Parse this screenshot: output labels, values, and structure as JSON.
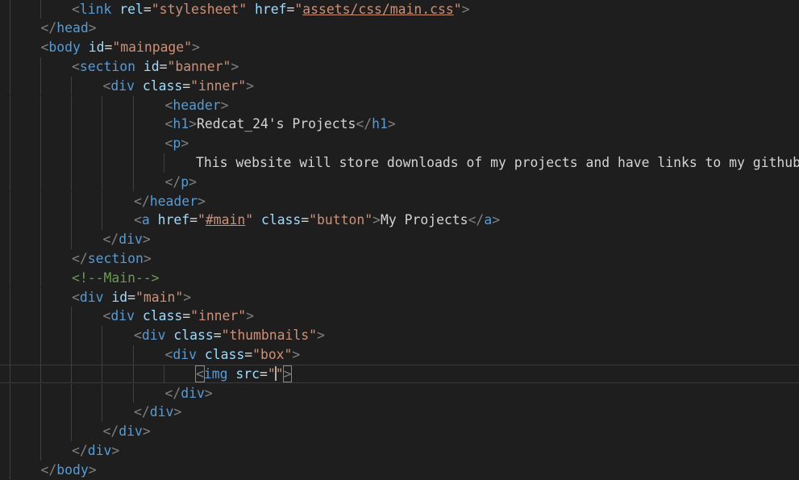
{
  "editor": {
    "language": "html",
    "lines": [
      {
        "indent": 2,
        "tokens": [
          {
            "k": "p",
            "v": "<"
          },
          {
            "k": "t",
            "v": "link"
          },
          {
            "k": "x",
            "v": " "
          },
          {
            "k": "a",
            "v": "rel"
          },
          {
            "k": "x",
            "v": "="
          },
          {
            "k": "s",
            "v": "\"stylesheet\""
          },
          {
            "k": "x",
            "v": " "
          },
          {
            "k": "a",
            "v": "href"
          },
          {
            "k": "x",
            "v": "="
          },
          {
            "k": "s",
            "v": "\""
          },
          {
            "k": "s",
            "v": "assets/css/main.css",
            "link": true
          },
          {
            "k": "s",
            "v": "\""
          },
          {
            "k": "p",
            "v": ">"
          }
        ]
      },
      {
        "indent": 1,
        "tokens": [
          {
            "k": "p",
            "v": "</"
          },
          {
            "k": "t",
            "v": "head"
          },
          {
            "k": "p",
            "v": ">"
          }
        ]
      },
      {
        "indent": 1,
        "tokens": [
          {
            "k": "p",
            "v": "<"
          },
          {
            "k": "t",
            "v": "body"
          },
          {
            "k": "x",
            "v": " "
          },
          {
            "k": "a",
            "v": "id"
          },
          {
            "k": "x",
            "v": "="
          },
          {
            "k": "s",
            "v": "\"mainpage\""
          },
          {
            "k": "p",
            "v": ">"
          }
        ]
      },
      {
        "indent": 2,
        "tokens": [
          {
            "k": "p",
            "v": "<"
          },
          {
            "k": "t",
            "v": "section"
          },
          {
            "k": "x",
            "v": " "
          },
          {
            "k": "a",
            "v": "id"
          },
          {
            "k": "x",
            "v": "="
          },
          {
            "k": "s",
            "v": "\"banner\""
          },
          {
            "k": "p",
            "v": ">"
          }
        ]
      },
      {
        "indent": 3,
        "tokens": [
          {
            "k": "p",
            "v": "<"
          },
          {
            "k": "t",
            "v": "div"
          },
          {
            "k": "x",
            "v": " "
          },
          {
            "k": "a",
            "v": "class"
          },
          {
            "k": "x",
            "v": "="
          },
          {
            "k": "s",
            "v": "\"inner\""
          },
          {
            "k": "p",
            "v": ">"
          }
        ]
      },
      {
        "indent": 5,
        "tokens": [
          {
            "k": "p",
            "v": "<"
          },
          {
            "k": "t",
            "v": "header"
          },
          {
            "k": "p",
            "v": ">"
          }
        ]
      },
      {
        "indent": 5,
        "tokens": [
          {
            "k": "p",
            "v": "<"
          },
          {
            "k": "t",
            "v": "h1"
          },
          {
            "k": "p",
            "v": ">"
          },
          {
            "k": "x",
            "v": "Redcat_24's Projects"
          },
          {
            "k": "p",
            "v": "</"
          },
          {
            "k": "t",
            "v": "h1"
          },
          {
            "k": "p",
            "v": ">"
          }
        ]
      },
      {
        "indent": 5,
        "tokens": [
          {
            "k": "p",
            "v": "<"
          },
          {
            "k": "t",
            "v": "p"
          },
          {
            "k": "p",
            "v": ">"
          }
        ]
      },
      {
        "indent": 6,
        "tokens": [
          {
            "k": "x",
            "v": "This website will store downloads of my projects and have links to my github."
          }
        ]
      },
      {
        "indent": 5,
        "tokens": [
          {
            "k": "p",
            "v": "</"
          },
          {
            "k": "t",
            "v": "p"
          },
          {
            "k": "p",
            "v": ">"
          }
        ]
      },
      {
        "indent": 4,
        "tokens": [
          {
            "k": "p",
            "v": "</"
          },
          {
            "k": "t",
            "v": "header"
          },
          {
            "k": "p",
            "v": ">"
          }
        ]
      },
      {
        "indent": 4,
        "tokens": [
          {
            "k": "p",
            "v": "<"
          },
          {
            "k": "t",
            "v": "a"
          },
          {
            "k": "x",
            "v": " "
          },
          {
            "k": "a",
            "v": "href"
          },
          {
            "k": "x",
            "v": "="
          },
          {
            "k": "s",
            "v": "\""
          },
          {
            "k": "s",
            "v": "#main",
            "link": true
          },
          {
            "k": "s",
            "v": "\""
          },
          {
            "k": "x",
            "v": " "
          },
          {
            "k": "a",
            "v": "class"
          },
          {
            "k": "x",
            "v": "="
          },
          {
            "k": "s",
            "v": "\"button\""
          },
          {
            "k": "p",
            "v": ">"
          },
          {
            "k": "x",
            "v": "My Projects"
          },
          {
            "k": "p",
            "v": "</"
          },
          {
            "k": "t",
            "v": "a"
          },
          {
            "k": "p",
            "v": ">"
          }
        ]
      },
      {
        "indent": 3,
        "tokens": [
          {
            "k": "p",
            "v": "</"
          },
          {
            "k": "t",
            "v": "div"
          },
          {
            "k": "p",
            "v": ">"
          }
        ]
      },
      {
        "indent": 2,
        "tokens": [
          {
            "k": "p",
            "v": "</"
          },
          {
            "k": "t",
            "v": "section"
          },
          {
            "k": "p",
            "v": ">"
          }
        ]
      },
      {
        "indent": 2,
        "tokens": [
          {
            "k": "c",
            "v": "<!--Main-->"
          }
        ]
      },
      {
        "indent": 2,
        "tokens": [
          {
            "k": "p",
            "v": "<"
          },
          {
            "k": "t",
            "v": "div"
          },
          {
            "k": "x",
            "v": " "
          },
          {
            "k": "a",
            "v": "id"
          },
          {
            "k": "x",
            "v": "="
          },
          {
            "k": "s",
            "v": "\"main\""
          },
          {
            "k": "p",
            "v": ">"
          }
        ]
      },
      {
        "indent": 3,
        "tokens": [
          {
            "k": "p",
            "v": "<"
          },
          {
            "k": "t",
            "v": "div"
          },
          {
            "k": "x",
            "v": " "
          },
          {
            "k": "a",
            "v": "class"
          },
          {
            "k": "x",
            "v": "="
          },
          {
            "k": "s",
            "v": "\"inner\""
          },
          {
            "k": "p",
            "v": ">"
          }
        ]
      },
      {
        "indent": 4,
        "tokens": [
          {
            "k": "p",
            "v": "<"
          },
          {
            "k": "t",
            "v": "div"
          },
          {
            "k": "x",
            "v": " "
          },
          {
            "k": "a",
            "v": "class"
          },
          {
            "k": "x",
            "v": "="
          },
          {
            "k": "s",
            "v": "\"thumbnails\""
          },
          {
            "k": "p",
            "v": ">"
          }
        ]
      },
      {
        "indent": 5,
        "tokens": [
          {
            "k": "p",
            "v": "<"
          },
          {
            "k": "t",
            "v": "div"
          },
          {
            "k": "x",
            "v": " "
          },
          {
            "k": "a",
            "v": "class"
          },
          {
            "k": "x",
            "v": "="
          },
          {
            "k": "s",
            "v": "\"box\""
          },
          {
            "k": "p",
            "v": ">"
          }
        ]
      },
      {
        "indent": 6,
        "current": true,
        "tokens": [
          {
            "k": "p",
            "v": "<",
            "bracket": true
          },
          {
            "k": "t",
            "v": "img"
          },
          {
            "k": "x",
            "v": " "
          },
          {
            "k": "a",
            "v": "src"
          },
          {
            "k": "x",
            "v": "="
          },
          {
            "k": "s",
            "v": "\""
          },
          {
            "k": "cursor",
            "v": ""
          },
          {
            "k": "s",
            "v": "\""
          },
          {
            "k": "p",
            "v": ">",
            "bracket": true
          }
        ]
      },
      {
        "indent": 5,
        "tokens": [
          {
            "k": "p",
            "v": "</"
          },
          {
            "k": "t",
            "v": "div"
          },
          {
            "k": "p",
            "v": ">"
          }
        ]
      },
      {
        "indent": 4,
        "tokens": [
          {
            "k": "p",
            "v": "</"
          },
          {
            "k": "t",
            "v": "div"
          },
          {
            "k": "p",
            "v": ">"
          }
        ]
      },
      {
        "indent": 3,
        "tokens": [
          {
            "k": "p",
            "v": "</"
          },
          {
            "k": "t",
            "v": "div"
          },
          {
            "k": "p",
            "v": ">"
          }
        ]
      },
      {
        "indent": 2,
        "tokens": [
          {
            "k": "p",
            "v": "</"
          },
          {
            "k": "t",
            "v": "div"
          },
          {
            "k": "p",
            "v": ">"
          }
        ]
      },
      {
        "indent": 1,
        "tokens": [
          {
            "k": "p",
            "v": "</"
          },
          {
            "k": "t",
            "v": "body"
          },
          {
            "k": "p",
            "v": ">"
          }
        ]
      }
    ]
  },
  "colors": {
    "background": "#1e1e1e",
    "punctuation": "#808080",
    "tag": "#569cd6",
    "attribute": "#9cdcfe",
    "string": "#ce9178",
    "comment": "#6a9955",
    "text": "#d4d4d4",
    "indent_guide": "#404040"
  }
}
